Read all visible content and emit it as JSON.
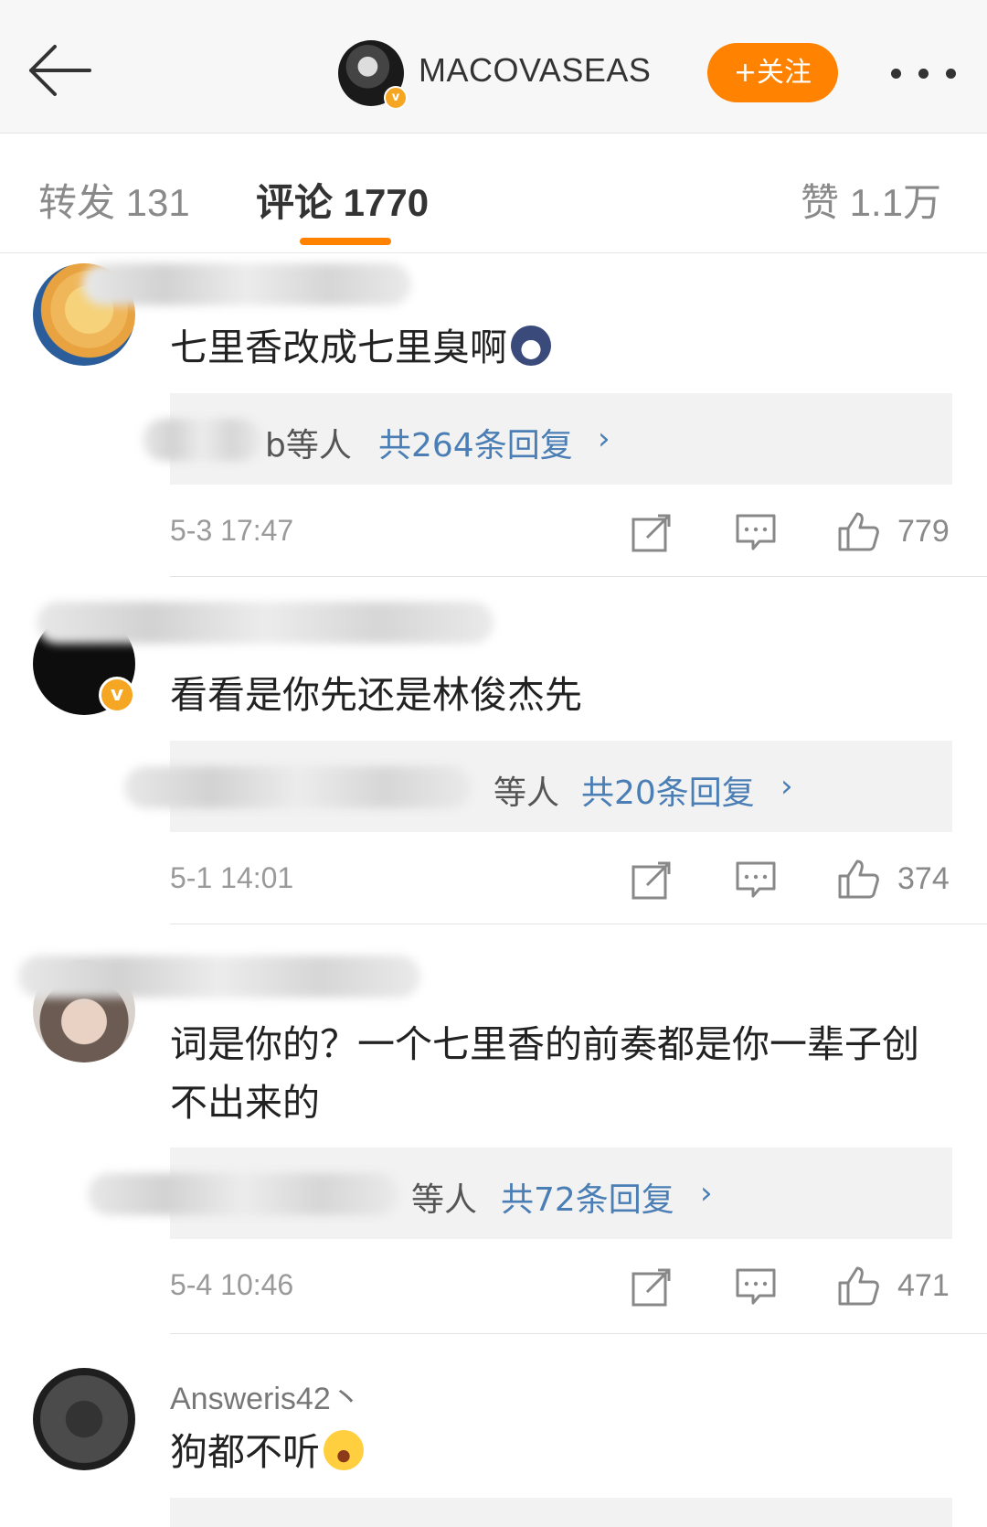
{
  "header": {
    "author_name": "MACOVASEAS",
    "follow_label": "+关注"
  },
  "tabs": [
    {
      "label": "转发 131"
    },
    {
      "label": "评论 1770"
    },
    {
      "label": "赞 1.1万"
    }
  ],
  "comments": [
    {
      "text": "七里香改成七里臭啊",
      "reply_who": "b等人",
      "reply_count": "共264条回复",
      "time": "5-3 17:47",
      "likes": "779"
    },
    {
      "text": "看看是你先还是林俊杰先",
      "reply_who": "等人",
      "reply_count": "共20条回复",
      "time": "5-1 14:01",
      "likes": "374"
    },
    {
      "text": "词是你的？一个七里香的前奏都是你一辈子创不出来的",
      "reply_who": "等人",
      "reply_count": "共72条回复",
      "time": "5-4 10:46",
      "likes": "471"
    },
    {
      "username": "Answeris42丶",
      "text": "狗都不听"
    }
  ],
  "colors": {
    "accent": "#ff8200",
    "link": "#4a7eb5",
    "verified": "#f5a623"
  },
  "icons": [
    "back-arrow-icon",
    "more-icon",
    "repost-icon",
    "comment-icon",
    "like-icon",
    "verified-icon"
  ]
}
